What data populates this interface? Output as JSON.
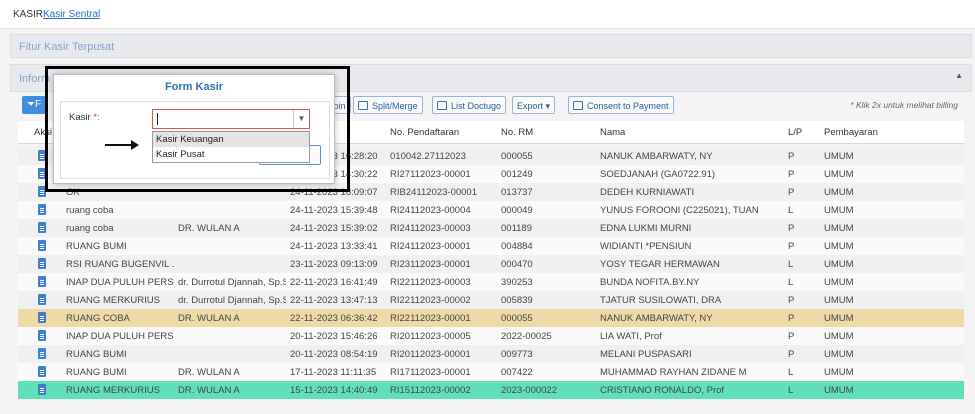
{
  "breadcrumb": {
    "root": "KASIR",
    "current": "Kasir Sentral"
  },
  "panels": {
    "fitur_title": "Fitur Kasir Terpusat",
    "info_title": "Inform"
  },
  "toolbar": {
    "filter_label": "F",
    "btn_join": "Join",
    "btn_split": "Split/Merge",
    "btn_doctugo": "List Doctugo",
    "btn_export": "Export",
    "btn_export_caret": "▾",
    "btn_consent": "Consent to Payment",
    "hint_star": "*",
    "hint_text": " Klik 2x untuk melihat billing"
  },
  "grid": {
    "headers": {
      "aksi": "Aksi",
      "no_pendaftaran": "No. Pendaftaran",
      "no_rm": "No. RM",
      "nama": "Nama",
      "lp": "L/P",
      "pembayaran": "Pembayaran"
    },
    "rows": [
      {
        "ruang": "",
        "dokter": "",
        "tanggal": "22-11-2023 16:28:20",
        "no_pendaftaran": "010042.27112023",
        "no_rm": "000055",
        "nama": "NANUK AMBARWATY, NY",
        "lp": "P",
        "pembayaran": "UMUM"
      },
      {
        "ruang": "",
        "dokter": "",
        "tanggal": "24-11-2023 14:30:22",
        "no_pendaftaran": "RI27112023-00001",
        "no_rm": "001249",
        "nama": "SOEDJANAH (GA0722.91)",
        "lp": "P",
        "pembayaran": "UMUM"
      },
      {
        "ruang": "OK",
        "dokter": "",
        "tanggal": "24-11-2023 18:09:07",
        "no_pendaftaran": "RIB24112023-00001",
        "no_rm": "013737",
        "nama": "DEDEH KURNIAWATI",
        "lp": "P",
        "pembayaran": "UMUM"
      },
      {
        "ruang": "ruang coba",
        "dokter": "",
        "tanggal": "24-11-2023 15:39:48",
        "no_pendaftaran": "RI24112023-00004",
        "no_rm": "000049",
        "nama": "YUNUS FOROONI (C225021), TUAN",
        "lp": "L",
        "pembayaran": "UMUM"
      },
      {
        "ruang": "ruang coba",
        "dokter": "DR. WULAN A",
        "tanggal": "24-11-2023 15:39:02",
        "no_pendaftaran": "RI24112023-00003",
        "no_rm": "001189",
        "nama": "EDNA LUKMI MURNI",
        "lp": "P",
        "pembayaran": "UMUM"
      },
      {
        "ruang": "RUANG BUMI",
        "dokter": "",
        "tanggal": "24-11-2023 13:33:41",
        "no_pendaftaran": "RI24112023-00001",
        "no_rm": "004884",
        "nama": "WIDIANTI *PENSIUN",
        "lp": "P",
        "pembayaran": "UMUM"
      },
      {
        "ruang": "RSI RUANG BUGENVIL ...",
        "dokter": "",
        "tanggal": "23-11-2023 09:13:09",
        "no_pendaftaran": "RI23112023-00001",
        "no_rm": "000470",
        "nama": "YOSY TEGAR HERMAWAN",
        "lp": "L",
        "pembayaran": "UMUM"
      },
      {
        "ruang": "INAP DUA PULUH PERS...",
        "dokter": "dr. Durrotul Djannah, Sp.S",
        "tanggal": "22-11-2023 16:41:49",
        "no_pendaftaran": "RI22112023-00003",
        "no_rm": "390253",
        "nama": "BUNDA NOFITA.BY.NY",
        "lp": "L",
        "pembayaran": "UMUM"
      },
      {
        "ruang": "RUANG MERKURIUS",
        "dokter": "dr. Durrotul Djannah, Sp.S",
        "tanggal": "22-11-2023 13:47:13",
        "no_pendaftaran": "RI22112023-00002",
        "no_rm": "005839",
        "nama": "TJATUR SUSILOWATI, DRA",
        "lp": "P",
        "pembayaran": "UMUM"
      },
      {
        "ruang": "RUANG COBA",
        "dokter": "DR. WULAN A",
        "tanggal": "22-11-2023 06:36:42",
        "no_pendaftaran": "RI22112023-00001",
        "no_rm": "000055",
        "nama": "NANUK AMBARWATY, NY",
        "lp": "P",
        "pembayaran": "UMUM"
      },
      {
        "ruang": "INAP DUA PULUH PERS...",
        "dokter": "",
        "tanggal": "20-11-2023 15:46:26",
        "no_pendaftaran": "RI20112023-00005",
        "no_rm": "2022-00025",
        "nama": "LIA WATI, Prof",
        "lp": "P",
        "pembayaran": "UMUM"
      },
      {
        "ruang": "RUANG BUMI",
        "dokter": "",
        "tanggal": "20-11-2023 08:54:19",
        "no_pendaftaran": "RI20112023-00001",
        "no_rm": "009773",
        "nama": "MELANI PUSPASARI",
        "lp": "P",
        "pembayaran": "UMUM"
      },
      {
        "ruang": "RUANG BUMI",
        "dokter": "DR. WULAN A",
        "tanggal": "17-11-2023 11:11:35",
        "no_pendaftaran": "RI17112023-00001",
        "no_rm": "007422",
        "nama": "MUHAMMAD RAYHAN ZIDANE M",
        "lp": "L",
        "pembayaran": "UMUM"
      },
      {
        "ruang": "RUANG MERKURIUS",
        "dokter": "DR. WULAN A",
        "tanggal": "15-11-2023 14:40:49",
        "no_pendaftaran": "RI15112023-00002",
        "no_rm": "2023-000022",
        "nama": "CRISTIANO RONALDO, Prof",
        "lp": "L",
        "pembayaran": "UMUM"
      }
    ]
  },
  "modal": {
    "title": "Form Kasir",
    "label": "Kasir",
    "required_mark": " *:",
    "options": [
      "Kasir Keuangan",
      "Kasir Pusat"
    ]
  },
  "colors": {
    "highlight_row": "#efd9a6",
    "selected_row": "#5fe0b9",
    "accent": "#2f6fb5"
  }
}
